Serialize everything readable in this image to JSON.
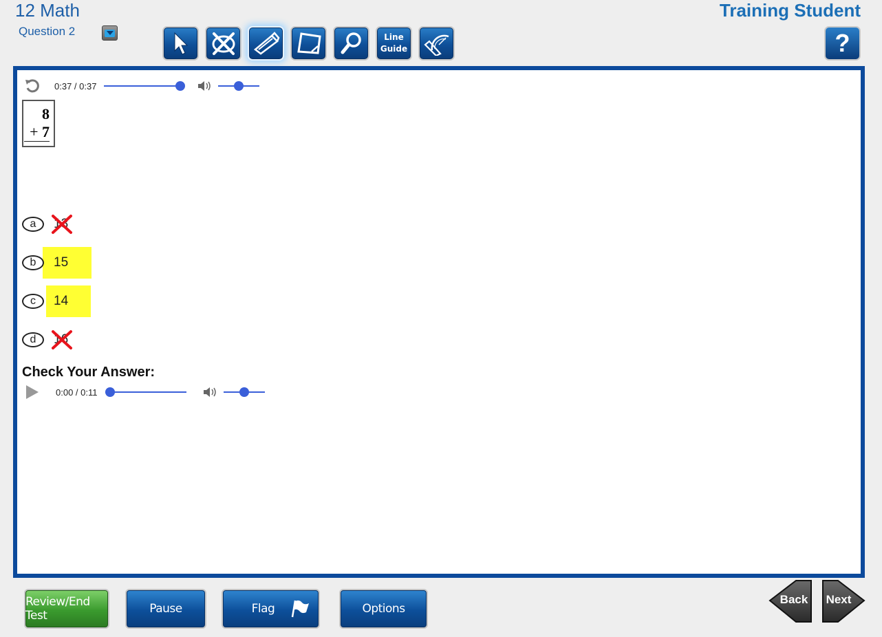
{
  "header": {
    "test_title": "12 Math",
    "question_label": "Question 2",
    "student_name": "Training Student",
    "help_label": "?"
  },
  "toolbar": {
    "tools": [
      {
        "name": "pointer-tool",
        "icon": "arrow-cursor-icon"
      },
      {
        "name": "answer-eliminator-tool",
        "icon": "eliminator-icon"
      },
      {
        "name": "highlighter-tool",
        "icon": "highlighter-icon",
        "active": true
      },
      {
        "name": "sticky-note-tool",
        "icon": "note-icon"
      },
      {
        "name": "magnifier-tool",
        "icon": "magnifier-icon"
      },
      {
        "name": "line-guide-tool",
        "label_line1": "Line",
        "label_line2": "Guide"
      },
      {
        "name": "protractor-tool",
        "icon": "ruler-protractor-icon"
      }
    ]
  },
  "question_audio": {
    "time": "0:37 / 0:37",
    "progress": 1.0,
    "volume": 0.5
  },
  "problem": {
    "top_number": "8",
    "operator": "+",
    "bottom_number": "7"
  },
  "choices": [
    {
      "letter": "a",
      "text": "13",
      "eliminated": true,
      "highlighted": false
    },
    {
      "letter": "b",
      "text": "15",
      "eliminated": false,
      "highlighted": true
    },
    {
      "letter": "c",
      "text": "14",
      "eliminated": false,
      "highlighted": true
    },
    {
      "letter": "d",
      "text": "16",
      "eliminated": true,
      "highlighted": false
    }
  ],
  "check_answer": {
    "label": "Check Your Answer:",
    "time": "0:00 / 0:11",
    "progress": 0.0,
    "volume": 0.5
  },
  "footer": {
    "review_label": "Review/End Test",
    "pause_label": "Pause",
    "flag_label": "Flag",
    "options_label": "Options",
    "back_label": "Back",
    "next_label": "Next"
  },
  "colors": {
    "brand_blue": "#0c4a9c",
    "highlight": "#ffff33",
    "eliminate_red": "#e8141c",
    "audio_blue": "#3a5fd9"
  }
}
